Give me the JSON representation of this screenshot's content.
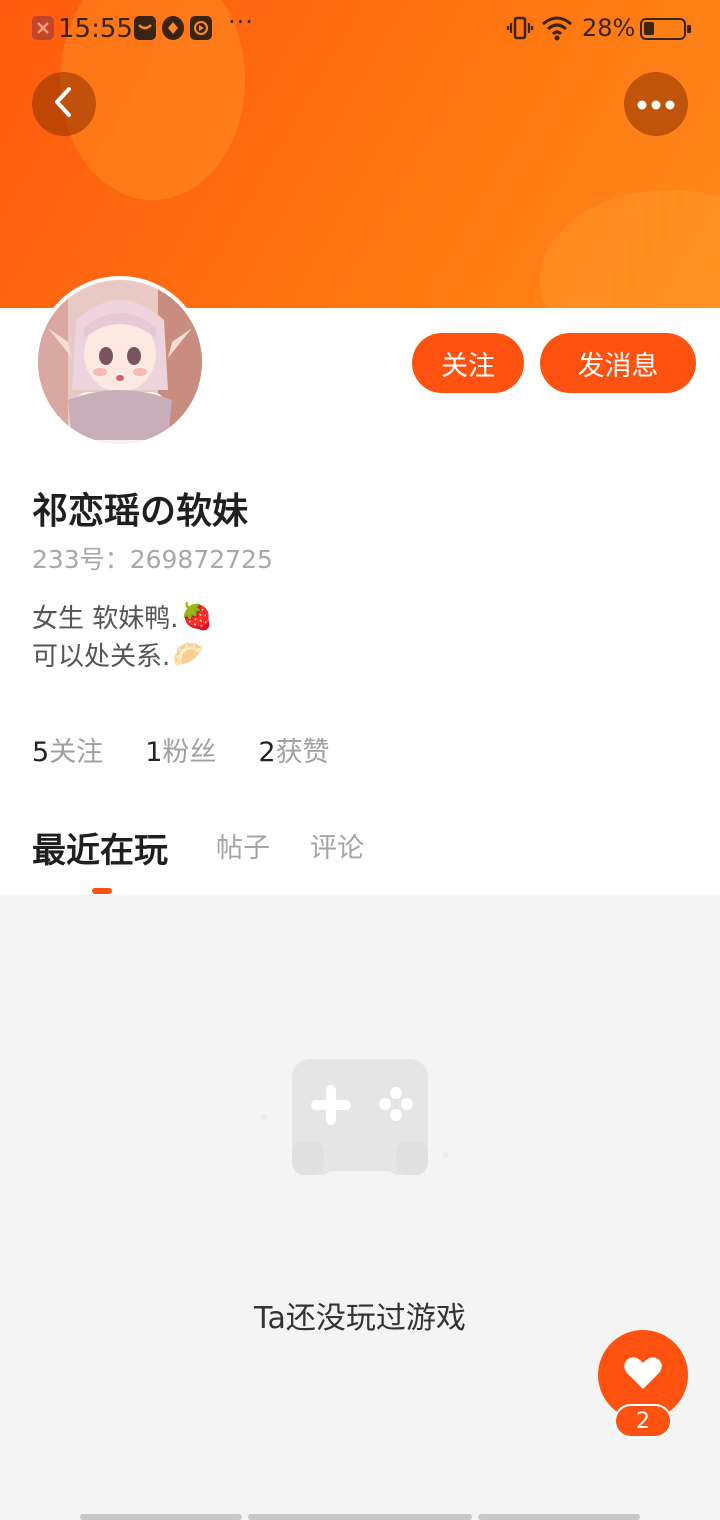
{
  "status_bar": {
    "time": "15:55",
    "more_indicator": "···",
    "battery_percent": "28%",
    "battery_level": 0.28,
    "icons": [
      "app-close-icon",
      "app-mail-icon",
      "app-map-icon",
      "app-play-icon",
      "vibrate-icon",
      "wifi-icon",
      "battery-icon"
    ]
  },
  "header": {
    "back_icon": "chevron-left-icon",
    "more_icon": "more-horizontal-icon"
  },
  "profile": {
    "name": "祁恋瑶の软妹",
    "uid": "233号：269872725",
    "bio_line1": "女生 软妹鸭.",
    "bio_line1_emoji": "🍓",
    "bio_line2": "可以处关系.",
    "bio_line2_emoji": "🥟"
  },
  "actions": {
    "follow_label": "关注",
    "message_label": "发消息"
  },
  "stats": [
    {
      "num": "5",
      "label": "关注"
    },
    {
      "num": "1",
      "label": "粉丝"
    },
    {
      "num": "2",
      "label": "获赞"
    }
  ],
  "tabs": [
    {
      "label": "最近在玩",
      "active": true
    },
    {
      "label": "帖子",
      "active": false
    },
    {
      "label": "评论",
      "active": false
    }
  ],
  "empty_state": {
    "icon": "gamepad-icon",
    "text": "Ta还没玩过游戏"
  },
  "like_fab": {
    "icon": "heart-icon",
    "count": "2"
  },
  "colors": {
    "accent": "#ff5210",
    "banner_start": "#ff5a0f",
    "banner_end": "#ff8a1c",
    "content_bg": "#f4f4f4"
  }
}
